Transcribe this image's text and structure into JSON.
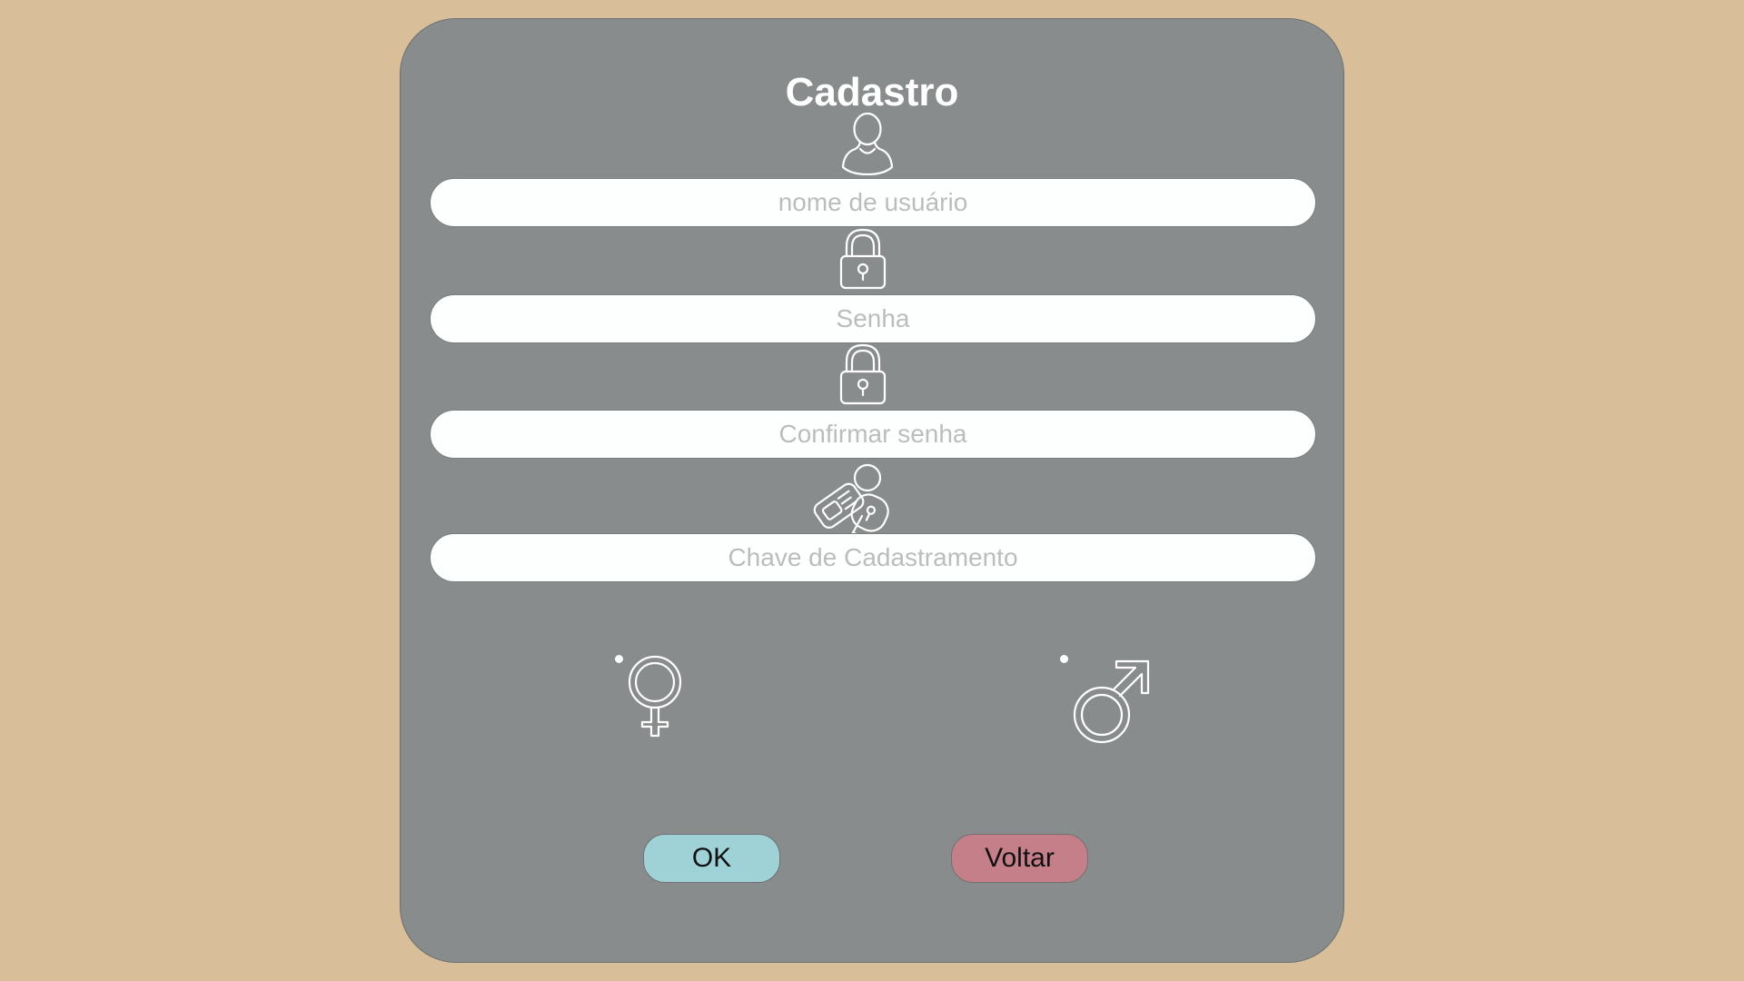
{
  "form": {
    "title": "Cadastro",
    "username": {
      "value": "",
      "placeholder": "nome de usuário"
    },
    "password": {
      "value": "",
      "placeholder": "Senha"
    },
    "confirm_password": {
      "value": "",
      "placeholder": "Confirmar senha"
    },
    "registration_key": {
      "value": "",
      "placeholder": "Chave de Cadastramento"
    }
  },
  "icons": {
    "username": "user-icon",
    "password": "lock-icon",
    "confirm_password": "lock-icon",
    "registration_key": "keys-icon",
    "female": "female-symbol-icon",
    "male": "male-symbol-icon"
  },
  "buttons": {
    "ok": {
      "label": "OK",
      "color": "#9fd2d6"
    },
    "back": {
      "label": "Voltar",
      "color": "#c47f88"
    }
  },
  "colors": {
    "background": "#d8be99",
    "panel": "#898c8c",
    "input_bg": "#fdffff",
    "placeholder": "#bcbcbc",
    "icon_stroke": "#ffffff"
  }
}
